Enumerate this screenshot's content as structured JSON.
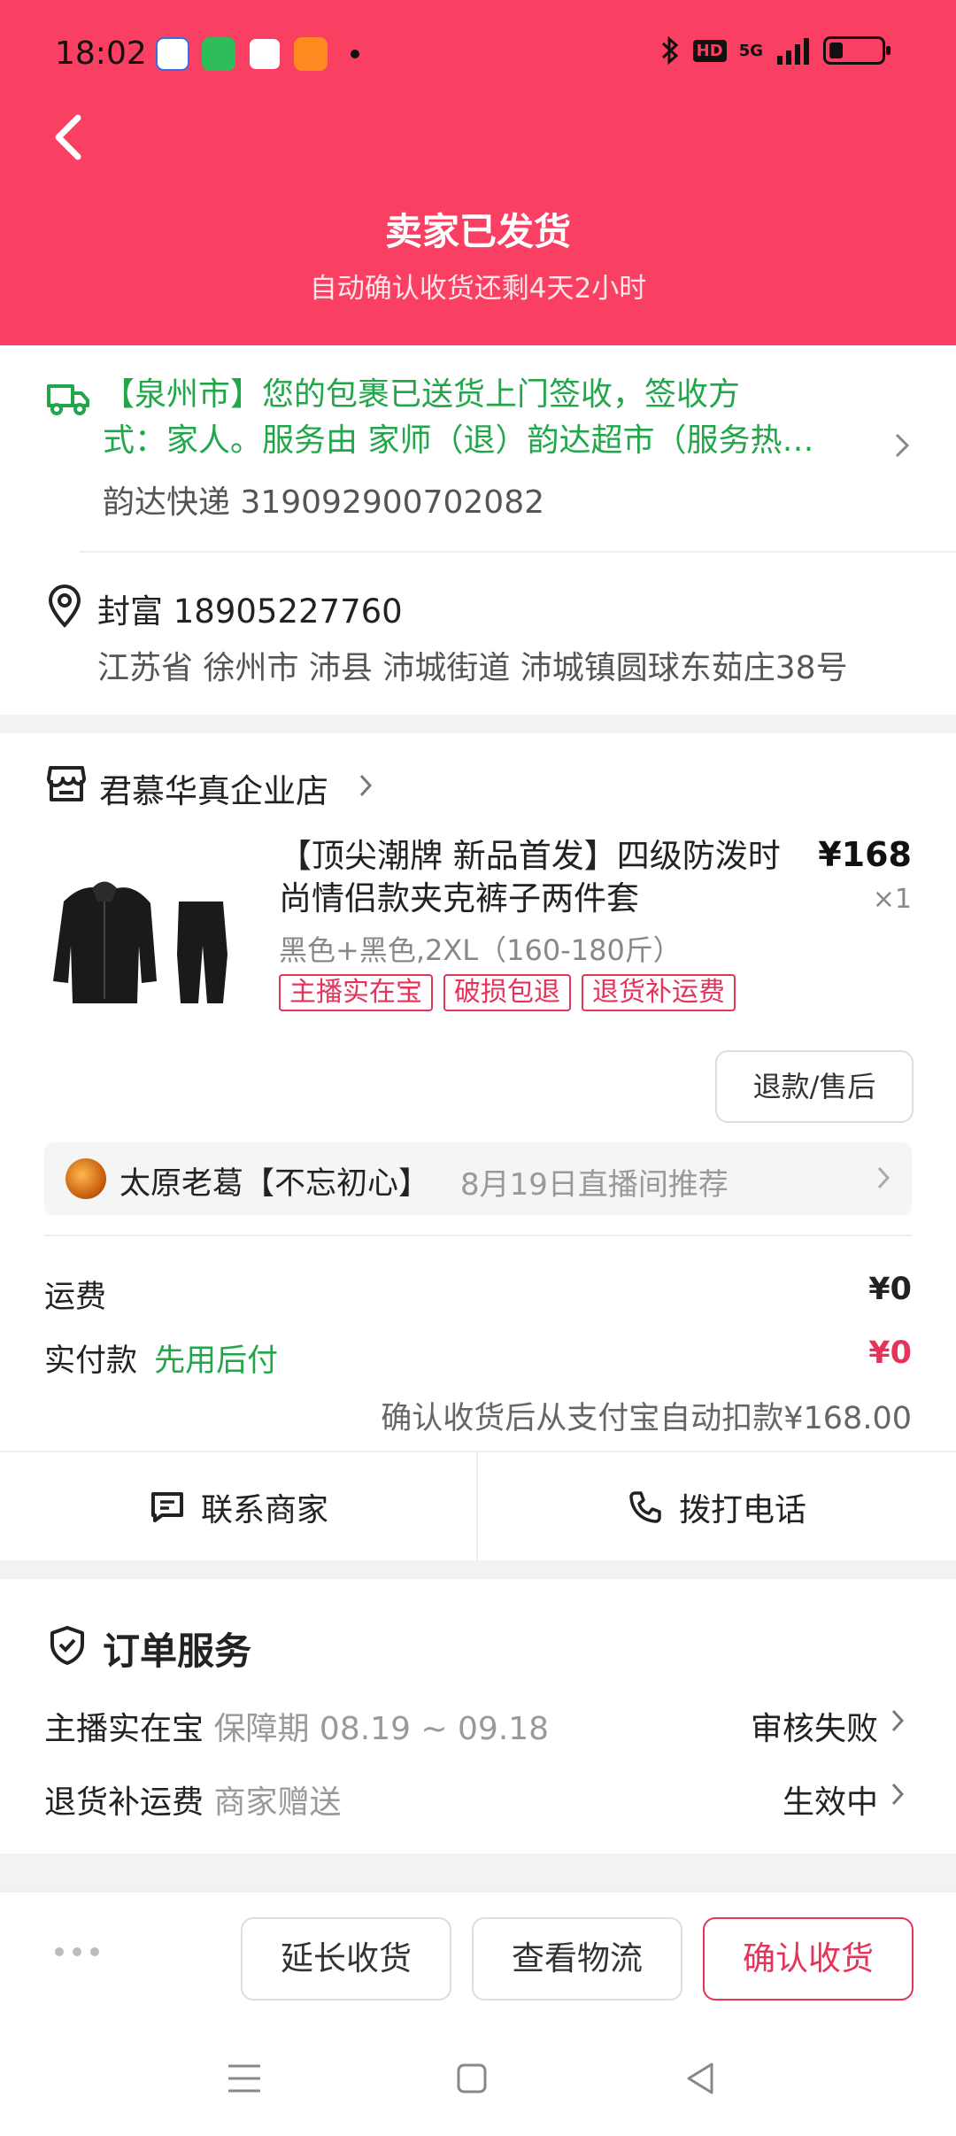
{
  "status_bar": {
    "time": "18:02",
    "network": "5G",
    "hd": "HD"
  },
  "header": {
    "title": "卖家已发货",
    "subtitle": "自动确认收货还剩4天2小时"
  },
  "logistics": {
    "message_line1": "【泉州市】您的包裹已送货上门签收，签收方",
    "message_line2": "式：家人。服务由 家师（退）韵达超市（服务热…",
    "tracking": "韵达快递 319092900702082"
  },
  "address": {
    "name_phone": "封富 18905227760",
    "detail": "江苏省 徐州市 沛县 沛城街道 沛城镇圆球东茹庄38号"
  },
  "shop": {
    "name": "君慕华真企业店"
  },
  "product": {
    "title": "【顶尖潮牌 新品首发】四级防泼时尚情侣款夹克裤子两件套",
    "price": "¥168",
    "qty": "×1",
    "sku": "黑色+黑色,2XL（160-180斤）",
    "tags": [
      "主播实在宝",
      "破损包退",
      "退货补运费"
    ],
    "refund_label": "退款/售后"
  },
  "recommend": {
    "name": "太原老葛【不忘初心】",
    "note": "8月19日直播间推荐"
  },
  "fees": {
    "shipping_label": "运费",
    "shipping_value": "¥0",
    "paid_label": "实付款",
    "paid_tag": "先用后付",
    "paid_value": "¥0",
    "auto_deduct": "确认收货后从支付宝自动扣款¥168.00"
  },
  "contact": {
    "merchant": "联系商家",
    "phone": "拨打电话"
  },
  "services": {
    "title": "订单服务",
    "items": [
      {
        "name": "主播实在宝",
        "detail": "保障期 08.19 ~ 09.18",
        "status": "审核失败"
      },
      {
        "name": "退货补运费",
        "detail": "商家赠送",
        "status": "生效中"
      }
    ]
  },
  "actions": {
    "extend": "延长收货",
    "logistics": "查看物流",
    "confirm": "确认收货"
  },
  "colors": {
    "header": "#f93f62",
    "accent": "#e5335a",
    "green": "#22a64a"
  }
}
